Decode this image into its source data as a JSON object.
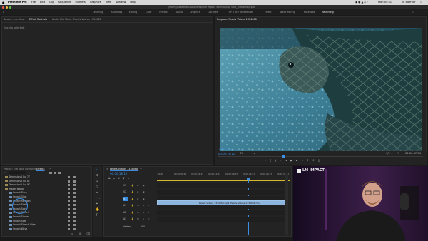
{
  "menubar": {
    "app": "Premiere Pro",
    "items": [
      "File",
      "Edit",
      "Clip",
      "Sequence",
      "Markers",
      "Graphics",
      "View",
      "Window",
      "Help"
    ],
    "clock": "Mon 05:41",
    "user": "Jin Boerhof"
  },
  "titlebar": {
    "path": "/Users/jinboerhof/Documents/Film impact Tutorials/Eye Wild_Overview.prproj"
  },
  "workspaces": [
    "Learning",
    "Assembly",
    "Editing",
    "Color",
    "Effects",
    "Audio",
    "Graphics",
    "Libraries",
    "FCP 3 pro for website",
    "Effect",
    "Wave editing",
    "Notebook",
    "Recording"
  ],
  "workspace_active": "Recording",
  "effect_panel": {
    "tabs": [
      "Source: (no clips)",
      "Effect Controls",
      "Audio Clip Mixer: Pexels Videos 1334068"
    ],
    "empty_message": "(no clip selected)"
  },
  "program": {
    "title": "Program: Pexels Videos 1334068",
    "timecode": "00:00:18:12",
    "zoom": "Fit",
    "resolution": "1/2",
    "duration": "00:00:37:04"
  },
  "effects": {
    "tabs": [
      "Project: Eye Wild_Overview",
      "Effects"
    ],
    "tree": [
      {
        "label": "Dimensional Lut 7T",
        "level": 1,
        "folder": true
      },
      {
        "label": "Dimensional Lut 8T",
        "level": 1,
        "folder": true
      },
      {
        "label": "Dimensional Lut 9T",
        "level": 1,
        "folder": true
      },
      {
        "label": "Impact Motion",
        "level": 1,
        "folder": true,
        "open": true
      },
      {
        "label": "Impact Flash",
        "level": 2,
        "folder": false
      },
      {
        "label": "Impact Glow",
        "level": 2,
        "folder": false
      },
      {
        "label": "Impact Random",
        "level": 2,
        "folder": false
      },
      {
        "label": "Impact Shake",
        "level": 2,
        "folder": false
      },
      {
        "label": "Impact Spin",
        "level": 2,
        "folder": false
      },
      {
        "label": "Impact Stretch",
        "level": 2,
        "folder": false
      },
      {
        "label": "Impact Strobe",
        "level": 2,
        "folder": false
      },
      {
        "label": "Impact Split",
        "level": 2,
        "folder": false
      },
      {
        "label": "Impact Stretch Wipe",
        "level": 2,
        "folder": false
      },
      {
        "label": "Impact Wave",
        "level": 2,
        "folder": false
      }
    ]
  },
  "tools": [
    "▸",
    "⇉",
    "⇆",
    "◇",
    "✂",
    "⟷",
    "✒",
    "✋",
    "T"
  ],
  "timeline": {
    "sequence_name": "Pexels Videos 1334068",
    "timecode": "00:00:18:12",
    "ruler_ticks": [
      ":00:00",
      "00:00:04:23",
      "00:00:09:23",
      "00:00:14:23",
      "00:00:19:23",
      "00:00:24:23",
      "00:00:29:23",
      "00:00:34:23"
    ],
    "tracks": [
      {
        "name": "V3",
        "kind": "video"
      },
      {
        "name": "V2",
        "kind": "video"
      },
      {
        "name": "V1",
        "kind": "video",
        "active": true
      },
      {
        "name": "A1",
        "kind": "audio"
      },
      {
        "name": "A2",
        "kind": "audio"
      },
      {
        "name": "A3",
        "kind": "audio"
      }
    ],
    "master_label": "Master",
    "master_value": "0.0",
    "clip_name": "Pexels Videos 1334068.mp4",
    "clip_name_2": "Pexels Videos 1334068.mp4"
  },
  "webcam": {
    "logo_text": "LM IMPACT"
  },
  "colors": {
    "accent": "#3b8fe0",
    "clip": "#8db4dc",
    "work_area": "#d6b82f"
  }
}
